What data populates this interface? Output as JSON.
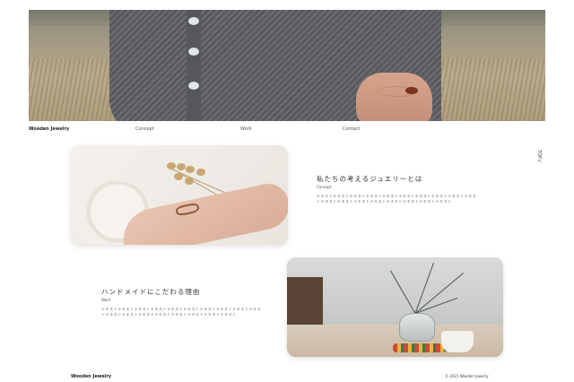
{
  "nav": {
    "brand": "Wooden Jewelry",
    "links": [
      "Concept",
      "Work",
      "Contact"
    ]
  },
  "side_label": "TOPへ",
  "sections": [
    {
      "heading": "私たちの考えるジュエリーとは",
      "sub": "Concept",
      "body": "テキストテキストテキストテキストテキストテキストテキストテキストテキストテキストテキストテキストテキストテキストテキストテキストテキストテキスト"
    },
    {
      "heading": "ハンドメイドにこだわる理由",
      "sub": "Work",
      "body": "テキストテキストテキストテキストテキストテキストテキストテキストテキストテキストテキストテキストテキストテキストテキストテキストテキストテキスト"
    }
  ],
  "footer": {
    "brand": "Wooden Jewelry",
    "copyright": "© 2021 Wooden Jewelry"
  },
  "colors": {
    "background": "#ffffff",
    "text": "#333333"
  }
}
